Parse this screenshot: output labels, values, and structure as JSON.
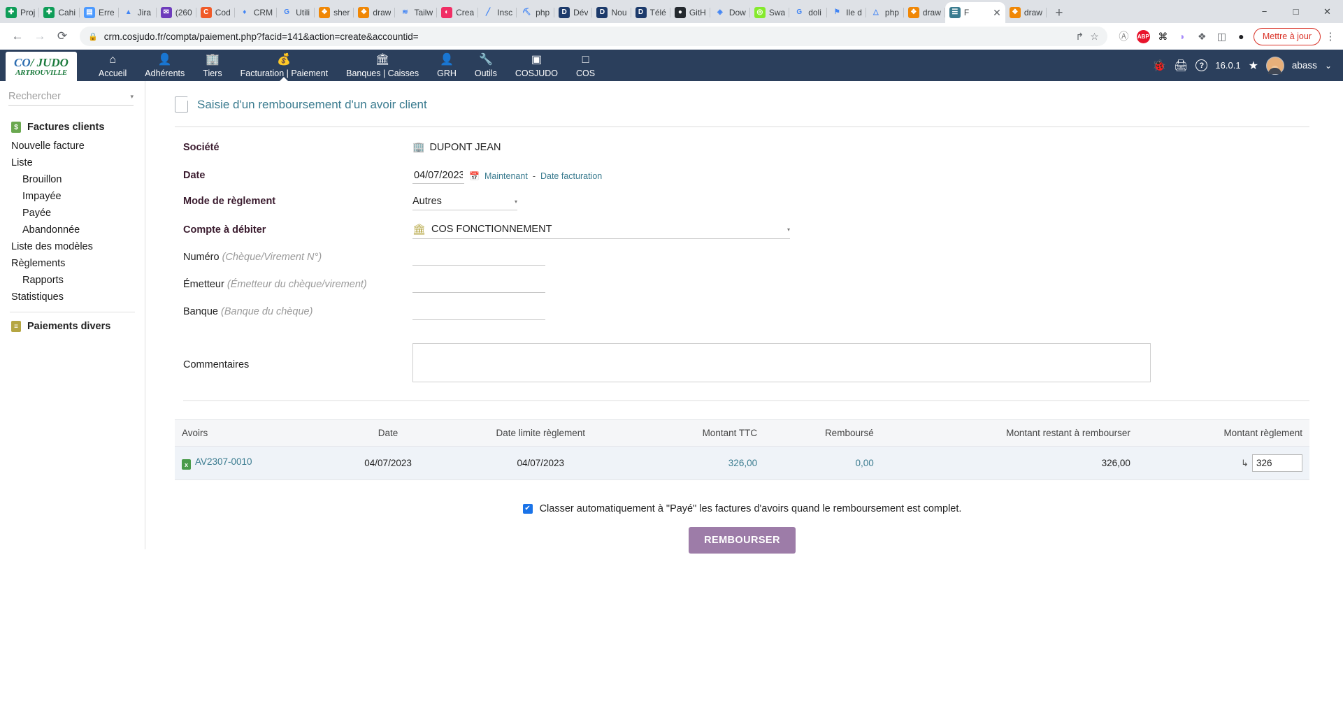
{
  "browser": {
    "tabs": [
      {
        "label": "Proj",
        "icon": "drive-icon",
        "color": "#0f9d58",
        "glyph": "✚",
        "active": false
      },
      {
        "label": "Cahi",
        "icon": "drive-icon",
        "color": "#0f9d58",
        "glyph": "✚",
        "active": false
      },
      {
        "label": "Erre",
        "icon": "trello-icon",
        "color": "#4c9aff",
        "glyph": "▤",
        "active": false
      },
      {
        "label": "Jira",
        "icon": "jira-icon",
        "color": "#ffffff",
        "glyph": "▲",
        "active": false
      },
      {
        "label": "(260",
        "icon": "mail-icon",
        "color": "#6e3cbc",
        "glyph": "✉",
        "active": false
      },
      {
        "label": "Cod",
        "icon": "codepen-icon",
        "color": "#f05a28",
        "glyph": "C",
        "active": false
      },
      {
        "label": "CRM",
        "icon": "crm-icon",
        "color": "#ffffff",
        "glyph": "♦",
        "active": false
      },
      {
        "label": "Utili",
        "icon": "google-icon",
        "color": "#ffffff",
        "glyph": "G",
        "active": false
      },
      {
        "label": "sher",
        "icon": "drawio-icon",
        "color": "#f08705",
        "glyph": "❖",
        "active": false
      },
      {
        "label": "draw",
        "icon": "drawio-icon",
        "color": "#f08705",
        "glyph": "❖",
        "active": false
      },
      {
        "label": "Tailw",
        "icon": "tailwind-icon",
        "color": "#ffffff",
        "glyph": "≋",
        "active": false
      },
      {
        "label": "Crea",
        "icon": "appwrite-icon",
        "color": "#f02e65",
        "glyph": "◐",
        "active": false
      },
      {
        "label": "Insc",
        "icon": "pen-icon",
        "color": "#ffffff",
        "glyph": "╱",
        "active": false
      },
      {
        "label": "php",
        "icon": "phpmyadmin-icon",
        "color": "#ffffff",
        "glyph": "⛏",
        "active": false
      },
      {
        "label": "Dév",
        "icon": "dolibarr-icon",
        "color": "#1c3a6b",
        "glyph": "D",
        "active": false
      },
      {
        "label": "Nou",
        "icon": "dolibarr-icon",
        "color": "#1c3a6b",
        "glyph": "D",
        "active": false
      },
      {
        "label": "Télé",
        "icon": "dolibarr-icon",
        "color": "#1c3a6b",
        "glyph": "D",
        "active": false
      },
      {
        "label": "GitH",
        "icon": "github-icon",
        "color": "#24292e",
        "glyph": "●",
        "active": false
      },
      {
        "label": "Dow",
        "icon": "diamond-icon",
        "color": "#ffffff",
        "glyph": "◈",
        "active": false
      },
      {
        "label": "Swa",
        "icon": "swagger-icon",
        "color": "#85ea2d",
        "glyph": "◎",
        "active": false
      },
      {
        "label": "doli",
        "icon": "google-icon",
        "color": "#ffffff",
        "glyph": "G",
        "active": false
      },
      {
        "label": "Ile d",
        "icon": "maps-icon",
        "color": "#ffffff",
        "glyph": "⚑",
        "active": false
      },
      {
        "label": "php",
        "icon": "drive-icon",
        "color": "#ffffff",
        "glyph": "△",
        "active": false
      },
      {
        "label": "draw",
        "icon": "drawio-icon",
        "color": "#f08705",
        "glyph": "❖",
        "active": false
      },
      {
        "label": "F",
        "icon": "cos-judo-icon",
        "color": "#3a7b8f",
        "glyph": "☰",
        "active": true
      },
      {
        "label": "draw",
        "icon": "drawio-icon",
        "color": "#f08705",
        "glyph": "❖",
        "active": false
      }
    ],
    "new_tab_label": "+",
    "window_controls": {
      "minimize": "−",
      "maximize": "□",
      "close": "✕"
    },
    "nav": {
      "back": "←",
      "forward": "→",
      "reload": "⟳"
    },
    "omnibox": {
      "lock_icon": "🔒",
      "url": "crm.cosjudo.fr/compta/paiement.php?facid=141&action=create&accountid=",
      "share_icon": "↱",
      "bookmark_icon": "☆"
    },
    "extensions": [
      {
        "name": "pocket-icon",
        "glyph": "Ⓐ",
        "color": "#8b8b8b"
      },
      {
        "name": "adblock-icon",
        "glyph": "ABP",
        "color": "#e8142c"
      },
      {
        "name": "extension-orange-icon",
        "glyph": "⌘",
        "color": "#1a1a1a"
      },
      {
        "name": "extension-purple-icon",
        "glyph": "◗",
        "color": "#a78bfa"
      },
      {
        "name": "puzzle-icon",
        "glyph": "❖",
        "color": "#5f6368"
      },
      {
        "name": "sidepanel-icon",
        "glyph": "◫",
        "color": "#5f6368"
      },
      {
        "name": "profile-dark-icon",
        "glyph": "●",
        "color": "#202124"
      }
    ],
    "update_button": "Mettre à jour",
    "menu_icon": "⋮"
  },
  "app_header": {
    "logo": {
      "line1_co": "CO",
      "line1_slash": "/",
      "line1_judo": "JUDO",
      "line2": "ARTROUVILLE"
    },
    "nav": [
      {
        "label": "Accueil",
        "icon": "home-icon",
        "glyph": "⌂",
        "selected": false
      },
      {
        "label": "Adhérents",
        "icon": "user-icon",
        "glyph": "👤",
        "selected": false
      },
      {
        "label": "Tiers",
        "icon": "building-icon",
        "glyph": "🏢",
        "selected": false
      },
      {
        "label": "Facturation | Paiement",
        "icon": "coins-icon",
        "glyph": "💰",
        "selected": true
      },
      {
        "label": "Banques | Caisses",
        "icon": "bank-icon",
        "glyph": "🏛",
        "selected": false
      },
      {
        "label": "GRH",
        "icon": "employee-icon",
        "glyph": "👤",
        "selected": false
      },
      {
        "label": "Outils",
        "icon": "wrench-icon",
        "glyph": "🔧",
        "selected": false
      },
      {
        "label": "COSJUDO",
        "icon": "module-icon",
        "glyph": "▣",
        "selected": false
      },
      {
        "label": "COS",
        "icon": "module-icon",
        "glyph": "□",
        "selected": false
      }
    ],
    "right": {
      "bug_icon": "🐞",
      "print_icon": "🖨",
      "help_icon": "?",
      "version": "16.0.1",
      "star_icon": "★",
      "user_name": "abass",
      "user_caret": "⌄"
    }
  },
  "sidebar": {
    "search_placeholder": "Rechercher",
    "search_caret": "▾",
    "sections": [
      {
        "title": "Factures clients",
        "icon": "invoice-icon",
        "icon_glyph": "$",
        "icon_color": "#6aa84f",
        "items": [
          {
            "label": "Nouvelle facture",
            "sub": false
          },
          {
            "label": "Liste",
            "sub": false
          },
          {
            "label": "Brouillon",
            "sub": true
          },
          {
            "label": "Impayée",
            "sub": true
          },
          {
            "label": "Payée",
            "sub": true
          },
          {
            "label": "Abandonnée",
            "sub": true
          },
          {
            "label": "Liste des modèles",
            "sub": false
          },
          {
            "label": "Règlements",
            "sub": false
          },
          {
            "label": "Rapports",
            "sub": true
          },
          {
            "label": "Statistiques",
            "sub": false
          }
        ]
      },
      {
        "title": "Paiements divers",
        "icon": "payment-icon",
        "icon_glyph": "≡",
        "icon_color": "#b5a642",
        "items": []
      }
    ]
  },
  "page": {
    "title": "Saisie d'un remboursement d'un avoir client",
    "doc_icon": "document-icon"
  },
  "form": {
    "societe": {
      "label": "Société",
      "value": "DUPONT JEAN",
      "icon": "building-icon"
    },
    "date": {
      "label": "Date",
      "value": "04/07/2023",
      "calendar_icon": "calendar-icon",
      "now_link": "Maintenant",
      "separator": "-",
      "billing_link": "Date facturation"
    },
    "mode_reglement": {
      "label": "Mode de règlement",
      "value": "Autres",
      "caret": "▾"
    },
    "compte_debiter": {
      "label": "Compte à débiter",
      "value": "COS FONCTIONNEMENT",
      "icon": "bank-icon",
      "caret": "▾"
    },
    "numero": {
      "label": "Numéro",
      "hint": "(Chèque/Virement N°)",
      "value": ""
    },
    "emetteur": {
      "label": "Émetteur",
      "hint": "(Émetteur du chèque/virement)",
      "value": ""
    },
    "banque": {
      "label": "Banque",
      "hint": "(Banque du chèque)",
      "value": ""
    },
    "commentaires": {
      "label": "Commentaires",
      "value": ""
    }
  },
  "table": {
    "headers": [
      "Avoirs",
      "Date",
      "Date limite règlement",
      "Montant TTC",
      "Remboursé",
      "Montant restant à rembourser",
      "Montant règlement"
    ],
    "rows": [
      {
        "ref": "AV2307-0010",
        "ref_icon": "credit-note-icon",
        "date": "04/07/2023",
        "date_limite": "04/07/2023",
        "montant_ttc": "326,00",
        "rembourse": "0,00",
        "restant": "326,00",
        "arrow": "↳",
        "montant_reglement": "326"
      }
    ]
  },
  "footer": {
    "checkbox_checked": true,
    "checkbox_glyph": "✔",
    "checkbox_label": "Classer automatiquement à \"Payé\" les factures d'avoirs quand le remboursement est complet.",
    "submit_label": "REMBOURSER"
  }
}
